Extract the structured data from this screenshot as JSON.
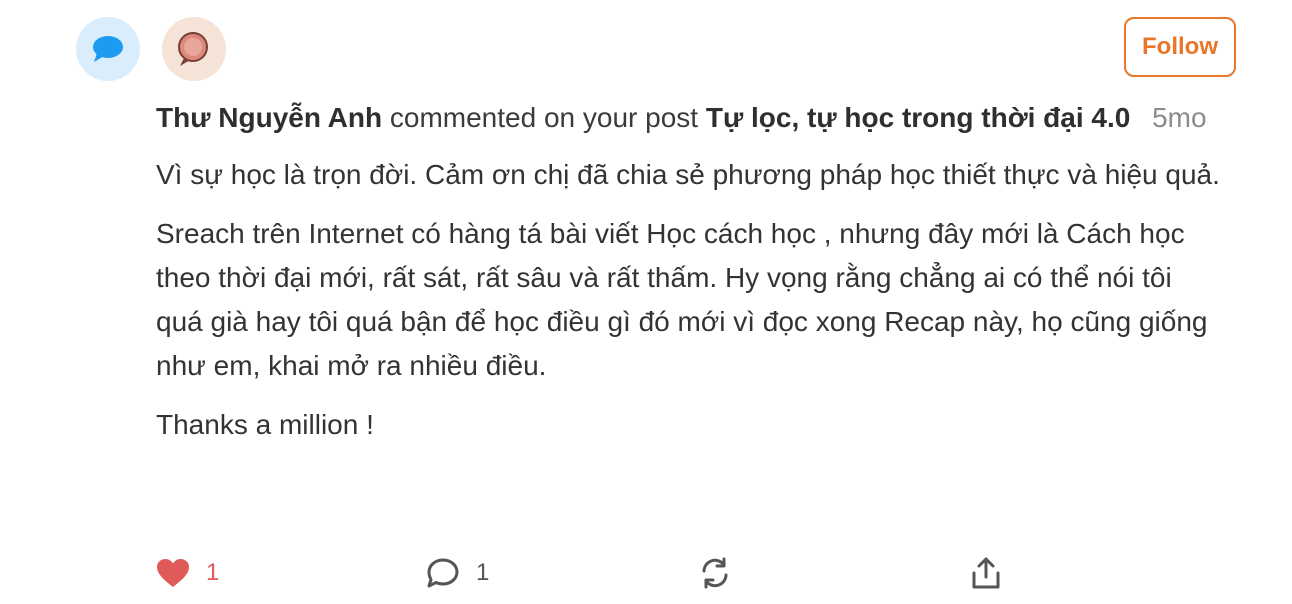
{
  "notification": {
    "type_icon": "speech-bubble-icon",
    "avatar_icon": "user-avatar",
    "follow_label": "Follow",
    "author": "Thư Nguyễn Anh",
    "action_text": "commented on your post",
    "post_title": "Tự lọc, tự học trong thời đại 4.0",
    "time_ago": "5mo",
    "comment_paragraphs": [
      "Vì sự học là trọn đời. Cảm ơn chị đã chia sẻ phương pháp học thiết thực và hiệu quả.",
      "Sreach trên Internet có hàng tá bài viết Học cách học , nhưng đây mới là Cách học theo thời đại mới, rất sát, rất sâu và rất thấm. Hy vọng rằng chẳng ai có thể nói tôi quá già hay tôi quá bận để học điều gì đó mới vì đọc xong Recap này, họ cũng giống như em, khai mở ra nhiều điều.",
      "Thanks a million !"
    ]
  },
  "actions": {
    "like_count": "1",
    "comment_count": "1",
    "like_icon": "heart-icon",
    "comment_icon": "comment-icon",
    "restack_icon": "restack-icon",
    "share_icon": "share-icon"
  },
  "colors": {
    "accent": "#e8762b",
    "like": "#e05a5a",
    "type_icon_bg": "#d9edfd",
    "type_icon_fg": "#1d9bf0"
  }
}
